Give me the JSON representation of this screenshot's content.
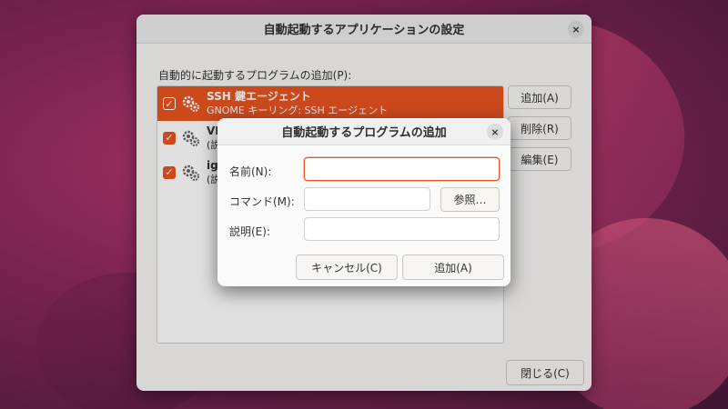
{
  "main_window": {
    "title": "自動起動するアプリケーションの設定",
    "close_icon": "×",
    "list_label": "自動的に起動するプログラムの追加(P):",
    "programs": [
      {
        "name": "SSH 鍵エージェント",
        "description": "GNOME キーリング: SSH エージェント",
        "checked": true,
        "selected": true
      },
      {
        "name": "VM",
        "description": "(説明",
        "checked": true,
        "selected": false
      },
      {
        "name": "ign",
        "description": "(説明",
        "checked": true,
        "selected": false
      }
    ],
    "buttons": {
      "add": "追加(A)",
      "remove": "削除(R)",
      "edit": "編集(E)",
      "close": "閉じる(C)"
    }
  },
  "dialog": {
    "title": "自動起動するプログラムの追加",
    "close_icon": "×",
    "fields": {
      "name_label": "名前(N):",
      "command_label": "コマンド(M):",
      "description_label": "説明(E):",
      "name_value": "",
      "command_value": "",
      "description_value": ""
    },
    "browse_label": "参照…",
    "cancel_label": "キャンセル(C)",
    "add_label": "追加(A)"
  },
  "colors": {
    "accent": "#e95420",
    "window_bg": "#f6f5f4"
  }
}
